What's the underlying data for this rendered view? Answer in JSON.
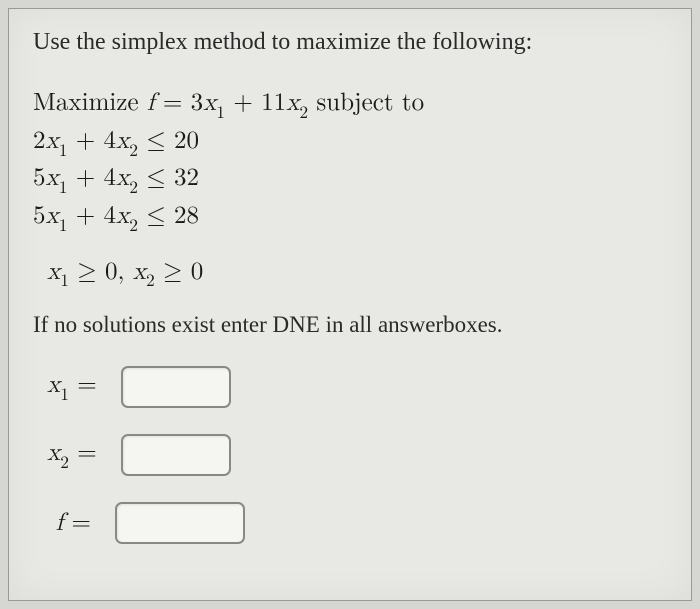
{
  "instruction": "Use the simplex method to maximize the following:",
  "problem": {
    "maximize_prefix": "Maximize ",
    "f_eq": "f",
    "eq_sign": " = ",
    "objective_rhs_a": "3",
    "objective_rhs_b": " + 11",
    "subject_to": " subject to",
    "c1_a": "2",
    "c1_b": " + 4",
    "c1_rhs": " ≤ 20",
    "c2_a": "5",
    "c2_b": " + 4",
    "c2_rhs": " ≤ 32",
    "c3_a": "5",
    "c3_b": " + 4",
    "c3_rhs": " ≤ 28",
    "nn_a": " ≥ 0, ",
    "nn_b": " ≥ 0",
    "x": "x",
    "s1": "1",
    "s2": "2"
  },
  "note": "If no solutions exist enter DNE in all answerboxes.",
  "answers": {
    "x1_label": "x",
    "x1_sub": "1",
    "x2_label": "x",
    "x2_sub": "2",
    "f_label": "f",
    "eq": "="
  }
}
